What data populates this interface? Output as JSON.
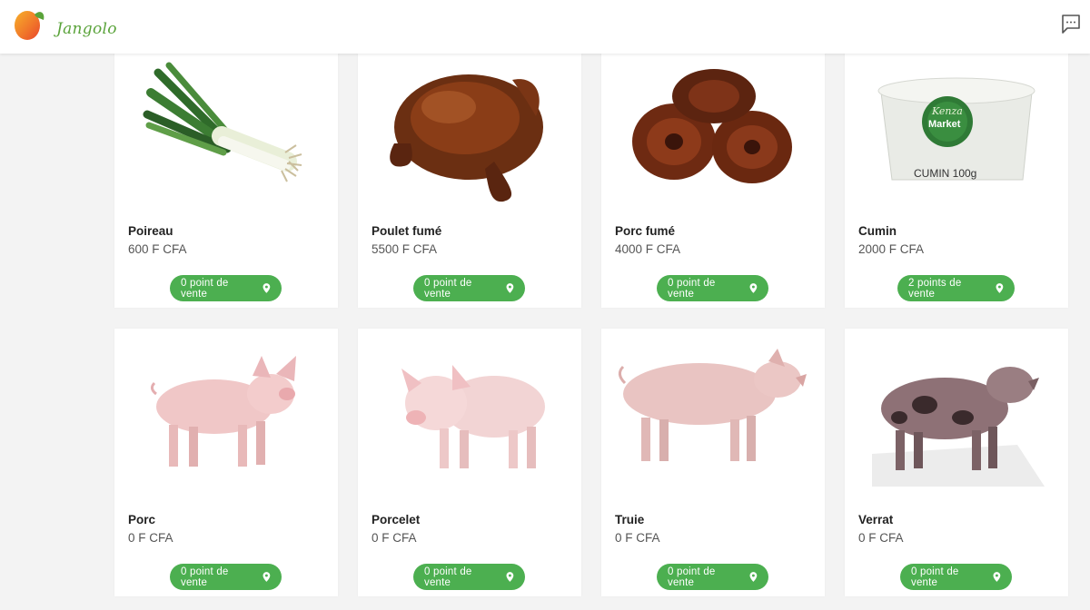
{
  "header": {
    "logo_text": "Jangolo",
    "chat_icon": "chat-icon"
  },
  "colors": {
    "accent": "#4caf50",
    "logo_green": "#5aa33a",
    "logo_orange": "#f28c28"
  },
  "products": [
    {
      "name": "Poireau",
      "price": "600 F CFA",
      "points": "0 point de vente",
      "icon": "leek-image"
    },
    {
      "name": "Poulet fumé",
      "price": "5500 F CFA",
      "points": "0 point de vente",
      "icon": "smoked-chicken-image"
    },
    {
      "name": "Porc fumé",
      "price": "4000 F CFA",
      "points": "0 point de vente",
      "icon": "smoked-pork-image"
    },
    {
      "name": "Cumin",
      "price": "2000 F CFA",
      "points": "2 points de vente",
      "icon": "cumin-tub-image",
      "label_lines": [
        "Kenza",
        "Market",
        "CUMIN 100g"
      ]
    },
    {
      "name": "Porc",
      "price": "0 F CFA",
      "points": "0 point de vente",
      "icon": "pig-image"
    },
    {
      "name": "Porcelet",
      "price": "0 F CFA",
      "points": "0 point de vente",
      "icon": "piglet-image"
    },
    {
      "name": "Truie",
      "price": "0 F CFA",
      "points": "0 point de vente",
      "icon": "sow-image"
    },
    {
      "name": "Verrat",
      "price": "0 F CFA",
      "points": "0 point de vente",
      "icon": "boar-image"
    }
  ]
}
